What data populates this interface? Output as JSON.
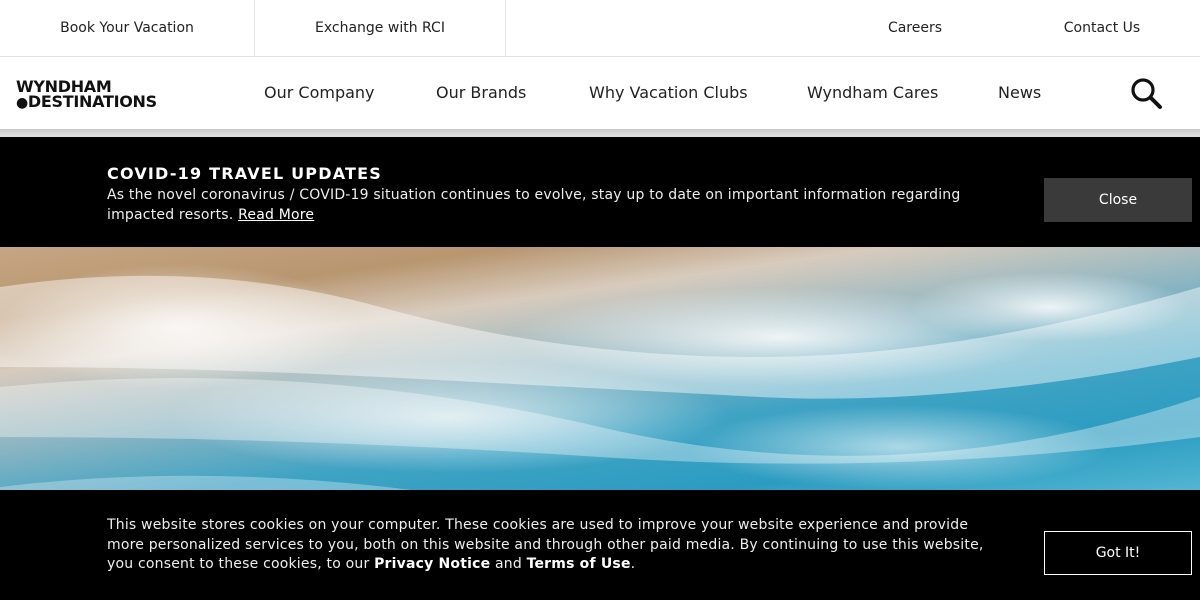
{
  "utility_nav": {
    "book": "Book Your Vacation",
    "rci": "Exchange with RCI",
    "careers": "Careers",
    "contact": "Contact Us"
  },
  "logo": {
    "line1": "WYNDHAM",
    "line2": "DESTINATIONS"
  },
  "main_nav": {
    "company": "Our Company",
    "brands": "Our Brands",
    "why": "Why Vacation Clubs",
    "cares": "Wyndham Cares",
    "news": "News",
    "search_icon": "search-icon"
  },
  "covid_banner": {
    "title": "COVID-19 TRAVEL UPDATES",
    "text": "As the novel coronavirus / COVID-19 situation continues to evolve, stay up to date on important information regarding impacted resorts.",
    "read_more": "Read More",
    "close": "Close"
  },
  "cookie_banner": {
    "text_part1": "This website stores cookies on your computer. These cookies are used to improve your website experience and provide more personalized services to you, both on this website and through other paid media. By continuing to use this website, you consent to these cookies, to our",
    "privacy": "Privacy Notice",
    "and": "and",
    "terms": "Terms of Use",
    "end": ".",
    "button": "Got It!"
  },
  "colors": {
    "banner_bg": "#000000",
    "close_bg": "#3a3a3a",
    "text_dark": "#222222"
  }
}
